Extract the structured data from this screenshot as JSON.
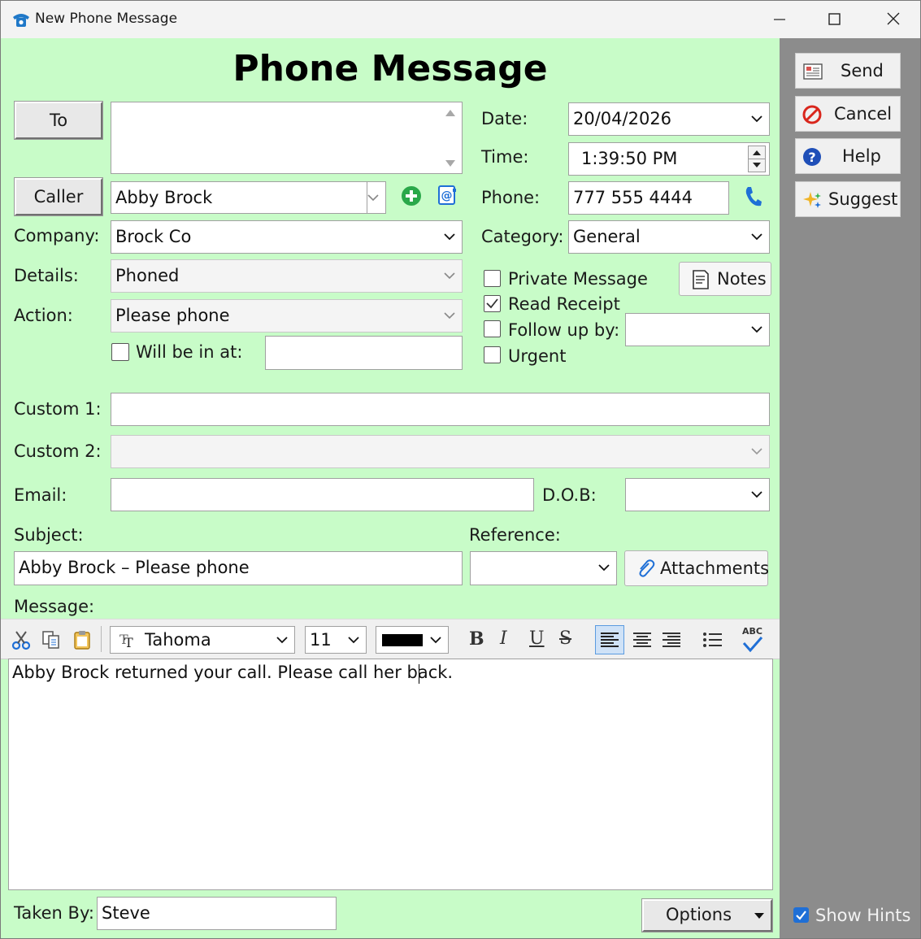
{
  "window": {
    "title": "New Phone Message"
  },
  "header": {
    "title": "Phone Message"
  },
  "to": {
    "button_label": "To",
    "value": ""
  },
  "caller": {
    "button_label": "Caller",
    "value": "Abby Brock"
  },
  "company": {
    "label": "Company:",
    "value": "Brock Co"
  },
  "details": {
    "label": "Details:",
    "value": "Phoned"
  },
  "action": {
    "label": "Action:",
    "value": "Please phone"
  },
  "will_be_in": {
    "label": "Will be in at:",
    "checked": false,
    "value": ""
  },
  "date": {
    "label": "Date:",
    "value": "20/04/2026"
  },
  "time": {
    "label": "Time:",
    "value": "1:39:50 PM"
  },
  "phone": {
    "label": "Phone:",
    "value": "777 555 4444"
  },
  "category": {
    "label": "Category:",
    "value": "General"
  },
  "options": {
    "private_message": {
      "label": "Private Message",
      "checked": false
    },
    "read_receipt": {
      "label": "Read Receipt",
      "checked": true
    },
    "follow_up": {
      "label": "Follow up by:",
      "checked": false,
      "value": ""
    },
    "urgent": {
      "label": "Urgent",
      "checked": false
    }
  },
  "notes_button": {
    "label": "Notes"
  },
  "custom1": {
    "label": "Custom 1:",
    "value": ""
  },
  "custom2": {
    "label": "Custom 2:",
    "value": ""
  },
  "email": {
    "label": "Email:",
    "value": ""
  },
  "dob": {
    "label": "D.O.B:",
    "value": ""
  },
  "subject": {
    "label": "Subject:",
    "value": "Abby Brock – Please phone"
  },
  "reference": {
    "label": "Reference:",
    "value": ""
  },
  "attachments_button": {
    "label": "Attachments"
  },
  "message": {
    "label": "Message:",
    "font": "Tahoma",
    "size": "11",
    "color": "#000000",
    "text": "Abby Brock returned your call. Please call her back.",
    "format_buttons": {
      "bold": "B",
      "italic": "I",
      "underline": "U",
      "strike": "S",
      "spell": "ABC"
    }
  },
  "taken_by": {
    "label": "Taken By:",
    "value": "Steve"
  },
  "options_button": {
    "label": "Options"
  },
  "sidebar": {
    "send": "Send",
    "cancel": "Cancel",
    "help": "Help",
    "suggest": "Suggest",
    "show_hints": {
      "label": "Show Hints",
      "checked": true
    }
  },
  "colors": {
    "form_bg": "#c8fcc8",
    "sidebar_bg": "#8c8c8c",
    "accent": "#1f6fd6"
  }
}
